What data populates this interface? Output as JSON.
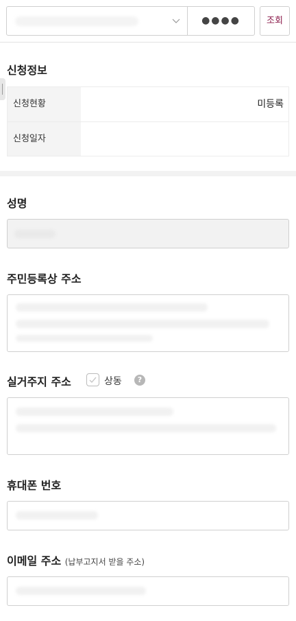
{
  "search": {
    "pin_mask": "●●●●",
    "button_label": "조회"
  },
  "application": {
    "title": "신청정보",
    "rows": [
      {
        "label": "신청현황",
        "value": "미등록"
      },
      {
        "label": "신청일자",
        "value": ""
      }
    ]
  },
  "form": {
    "name_label": "성명",
    "address_label": "주민등록상 주소",
    "residence_label": "실거주지 주소",
    "same_label": "상동",
    "help_glyph": "?",
    "phone_label": "휴대폰 번호",
    "email_label": "이메일 주소",
    "email_note": "(납부고지서 받을 주소)"
  }
}
